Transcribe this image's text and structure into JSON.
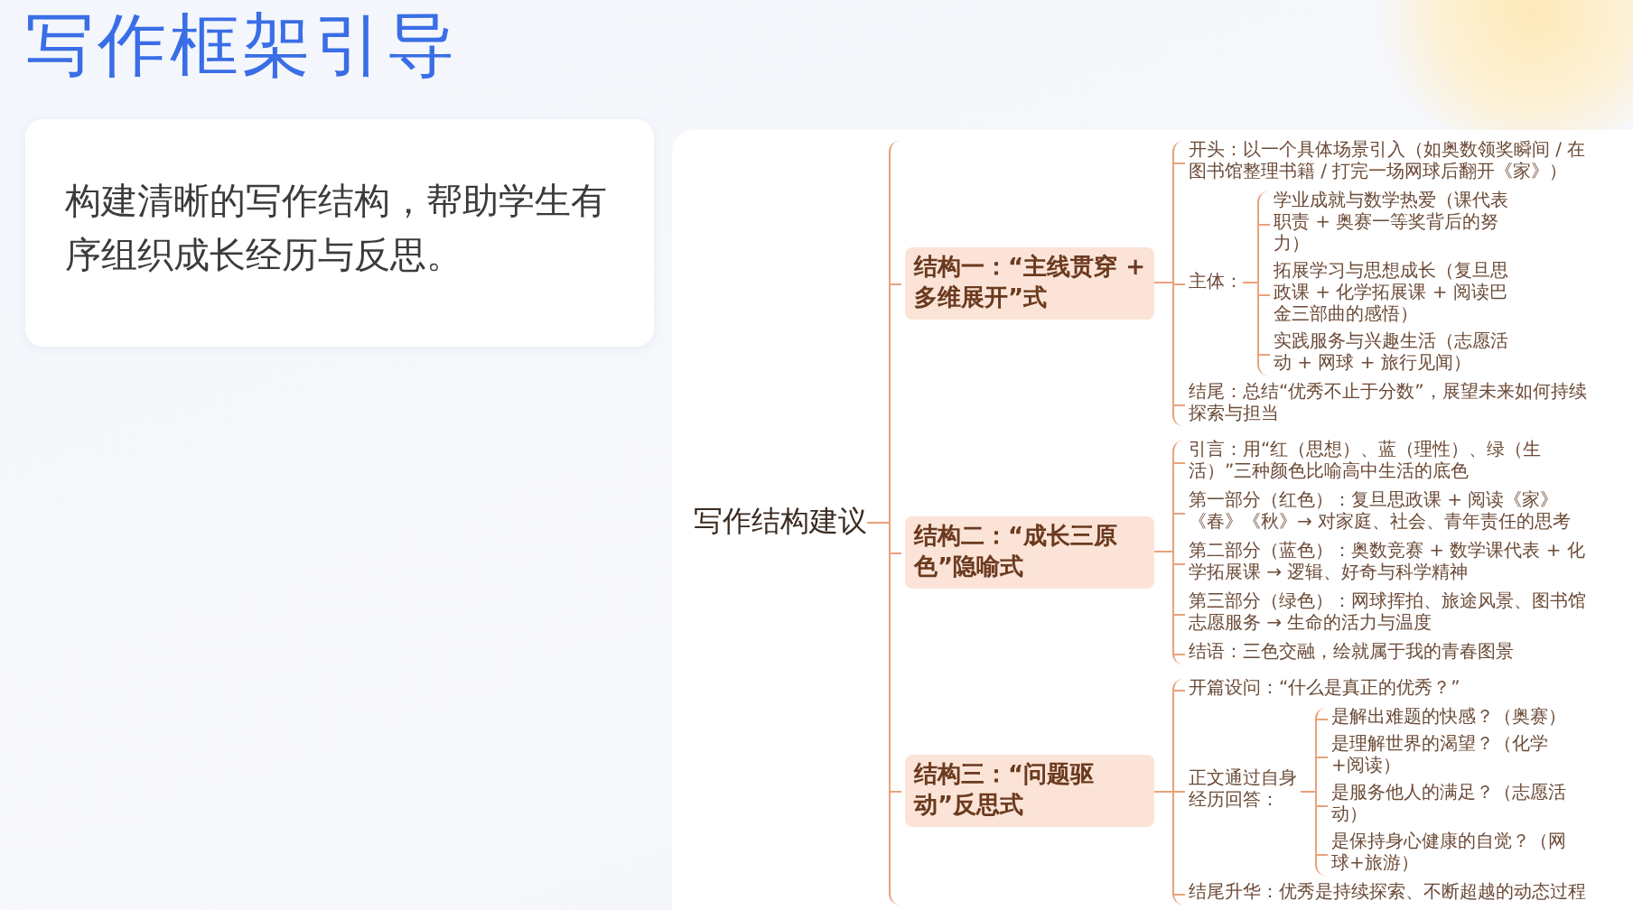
{
  "title": "写作框架引导",
  "intro": "构建清晰的写作结构，帮助学生有序组织成长经历与反思。",
  "mindmap": {
    "root": "写作结构建议",
    "branches": [
      {
        "label": "结构一：“主线贯穿 + 多维展开”式",
        "children": [
          {
            "text": "开头：以一个具体场景引入（如奥数领奖瞬间 / 在图书馆整理书籍 / 打完一场网球后翻开《家》）"
          },
          {
            "text": "主体：",
            "children": [
              {
                "text": "学业成就与数学热爱（课代表职责 + 奥赛一等奖背后的努力）"
              },
              {
                "text": "拓展学习与思想成长（复旦思政课 + 化学拓展课 + 阅读巴金三部曲的感悟）"
              },
              {
                "text": "实践服务与兴趣生活（志愿活动 + 网球 + 旅行见闻）"
              }
            ]
          },
          {
            "text": "结尾：总结“优秀不止于分数”，展望未来如何持续探索与担当"
          }
        ]
      },
      {
        "label": "结构二：“成长三原色”隐喻式",
        "children": [
          {
            "text": "引言：用“红（思想）、蓝（理性）、绿（生活）”三种颜色比喻高中生活的底色"
          },
          {
            "text": "第一部分（红色）：复旦思政课 + 阅读《家》《春》《秋》→ 对家庭、社会、青年责任的思考"
          },
          {
            "text": "第二部分（蓝色）：奥数竞赛 + 数学课代表 + 化学拓展课 → 逻辑、好奇与科学精神"
          },
          {
            "text": "第三部分（绿色）：网球挥拍、旅途风景、图书馆志愿服务 → 生命的活力与温度"
          },
          {
            "text": "结语：三色交融，绘就属于我的青春图景"
          }
        ]
      },
      {
        "label": "结构三：“问题驱动”反思式",
        "children": [
          {
            "text": "开篇设问：“什么是真正的优秀？”"
          },
          {
            "text": "正文通过自身经历回答：",
            "children": [
              {
                "text": "是解出难题的快感？（奥赛）"
              },
              {
                "text": "是理解世界的渴望？（化学+阅读）"
              },
              {
                "text": "是服务他人的满足？（志愿活动）"
              },
              {
                "text": "是保持身心健康的自觉？（网球+旅游）"
              }
            ]
          },
          {
            "text": "结尾升华：优秀是持续探索、不断超越的动态过程"
          }
        ]
      }
    ]
  }
}
